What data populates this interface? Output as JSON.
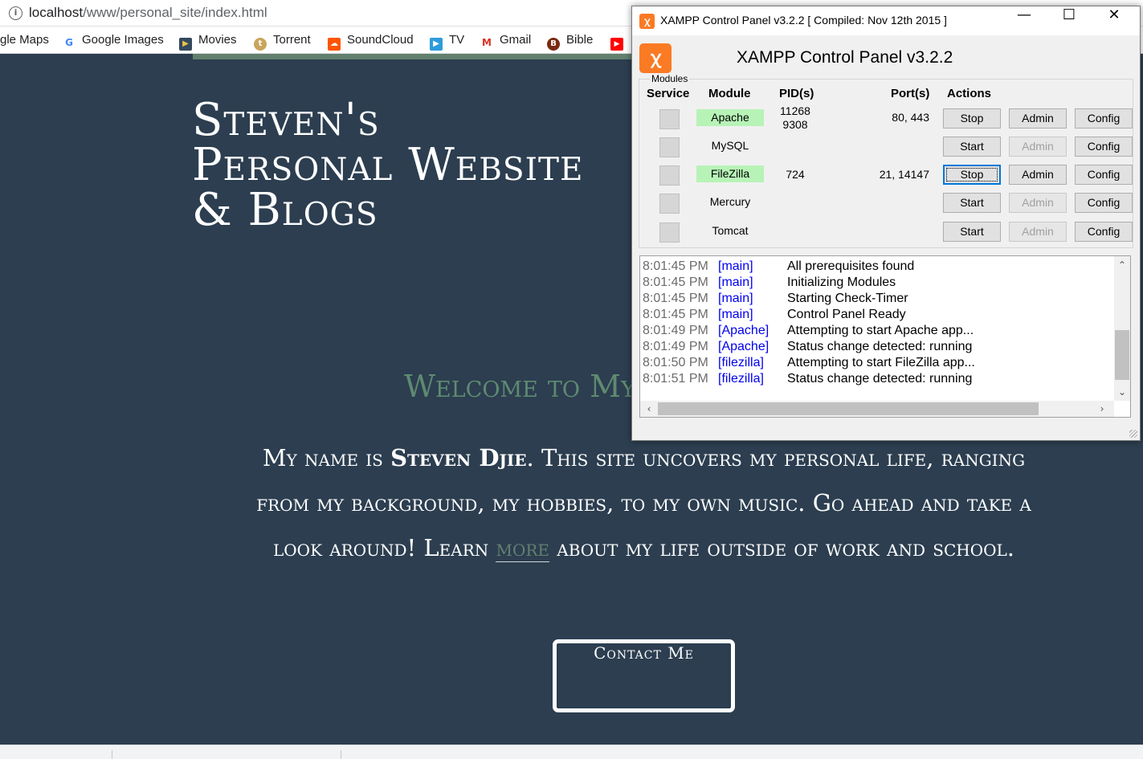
{
  "browser": {
    "url_host": "localhost",
    "url_path": "/www/personal_site/index.html",
    "bookmarks": [
      {
        "label": "gle Maps",
        "icon": "maps-icon"
      },
      {
        "label": "Google Images",
        "icon": "google-icon"
      },
      {
        "label": "Movies",
        "icon": "movies-icon"
      },
      {
        "label": "Torrent",
        "icon": "torrent-icon"
      },
      {
        "label": "SoundCloud",
        "icon": "soundcloud-icon"
      },
      {
        "label": "TV",
        "icon": "tv-icon"
      },
      {
        "label": "Gmail",
        "icon": "gmail-icon"
      },
      {
        "label": "Bible",
        "icon": "bible-icon"
      },
      {
        "label": "",
        "icon": "youtube-icon"
      }
    ]
  },
  "site": {
    "title_lines": [
      "Steven's",
      "Personal Website",
      "& Blogs"
    ],
    "welcome": "Welcome to My Site",
    "intro_1": "My name is ",
    "intro_name": "Steven Djie",
    "intro_2": ". This site uncovers my personal life, ranging from my background, my hobbies, to my own music. Go ahead and take a look around! Learn ",
    "intro_link": "more",
    "intro_3": " about my life outside of work and school.",
    "contact_label": "Contact Me",
    "colors": {
      "background": "#2c3e50",
      "accent": "#62806e",
      "text": "#ffffff"
    }
  },
  "xampp": {
    "window_title": "XAMPP Control Panel v3.2.2   [ Compiled: Nov 12th 2015 ]",
    "header_title": "XAMPP Control Panel v3.2.2",
    "modules_label": "Modules",
    "columns": {
      "service": "Service",
      "module": "Module",
      "pid": "PID(s)",
      "port": "Port(s)",
      "actions": "Actions"
    },
    "modules": [
      {
        "name": "Apache",
        "running": true,
        "pid": "11268\n9308",
        "port": "80, 443",
        "action": "Stop",
        "admin": "Admin",
        "admin_enabled": true,
        "config": "Config",
        "focused": false
      },
      {
        "name": "MySQL",
        "running": false,
        "pid": "",
        "port": "",
        "action": "Start",
        "admin": "Admin",
        "admin_enabled": false,
        "config": "Config",
        "focused": false
      },
      {
        "name": "FileZilla",
        "running": true,
        "pid": "724",
        "port": "21, 14147",
        "action": "Stop",
        "admin": "Admin",
        "admin_enabled": true,
        "config": "Config",
        "focused": true
      },
      {
        "name": "Mercury",
        "running": false,
        "pid": "",
        "port": "",
        "action": "Start",
        "admin": "Admin",
        "admin_enabled": false,
        "config": "Config",
        "focused": false
      },
      {
        "name": "Tomcat",
        "running": false,
        "pid": "",
        "port": "",
        "action": "Start",
        "admin": "Admin",
        "admin_enabled": false,
        "config": "Config",
        "focused": false
      }
    ],
    "log": [
      {
        "time": "8:01:45 PM",
        "source": "[main]",
        "message": "All prerequisites found"
      },
      {
        "time": "8:01:45 PM",
        "source": "[main]",
        "message": "Initializing Modules"
      },
      {
        "time": "8:01:45 PM",
        "source": "[main]",
        "message": "Starting Check-Timer"
      },
      {
        "time": "8:01:45 PM",
        "source": "[main]",
        "message": "Control Panel Ready"
      },
      {
        "time": "8:01:49 PM",
        "source": "[Apache]",
        "message": "Attempting to start Apache app..."
      },
      {
        "time": "8:01:49 PM",
        "source": "[Apache]",
        "message": "Status change detected: running"
      },
      {
        "time": "8:01:50 PM",
        "source": "[filezilla]",
        "message": "Attempting to start FileZilla app..."
      },
      {
        "time": "8:01:51 PM",
        "source": "[filezilla]",
        "message": "Status change detected: running"
      }
    ]
  }
}
